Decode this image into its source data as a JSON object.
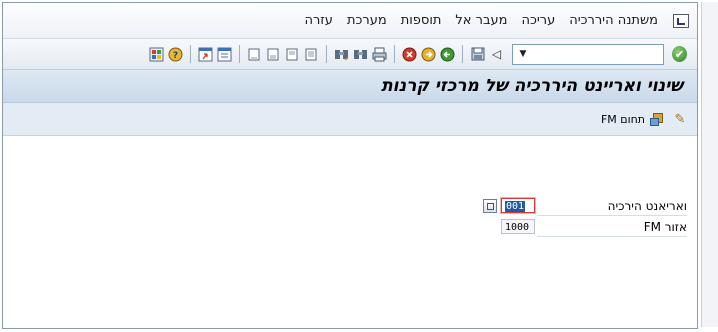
{
  "menu": {
    "items": [
      "משתנה היררכיה",
      "עריכה",
      "מעבר אל",
      "תוספות",
      "מערכת",
      "עזרה"
    ]
  },
  "toolbar": {
    "command_value": "",
    "icons": [
      "enter-icon",
      "command-dropdown-icon",
      "forward-icon",
      "save-icon",
      "back-icon",
      "exit-icon",
      "cancel-icon",
      "print-icon",
      "find-icon",
      "find-next-icon",
      "first-page-icon",
      "previous-page-icon",
      "next-page-icon",
      "last-page-icon",
      "create-session-icon",
      "shortcut-icon",
      "help-icon",
      "customize-layout-icon"
    ]
  },
  "title": {
    "text": "שינוי ואריינט היררכיה של מרכזי קרנות"
  },
  "app_toolbar": {
    "fm_area_label": "תחום FM"
  },
  "form": {
    "fields": [
      {
        "label": "ואריאנט הירכיה",
        "value": "001"
      },
      {
        "label": "אזור FM",
        "value": "1000"
      }
    ]
  },
  "colors": {
    "title_bg": "#c9d9ea",
    "app_toolbar_bg": "#e3ecf5",
    "selection": "#1e5aa8",
    "focus_border": "#d23a3a"
  }
}
